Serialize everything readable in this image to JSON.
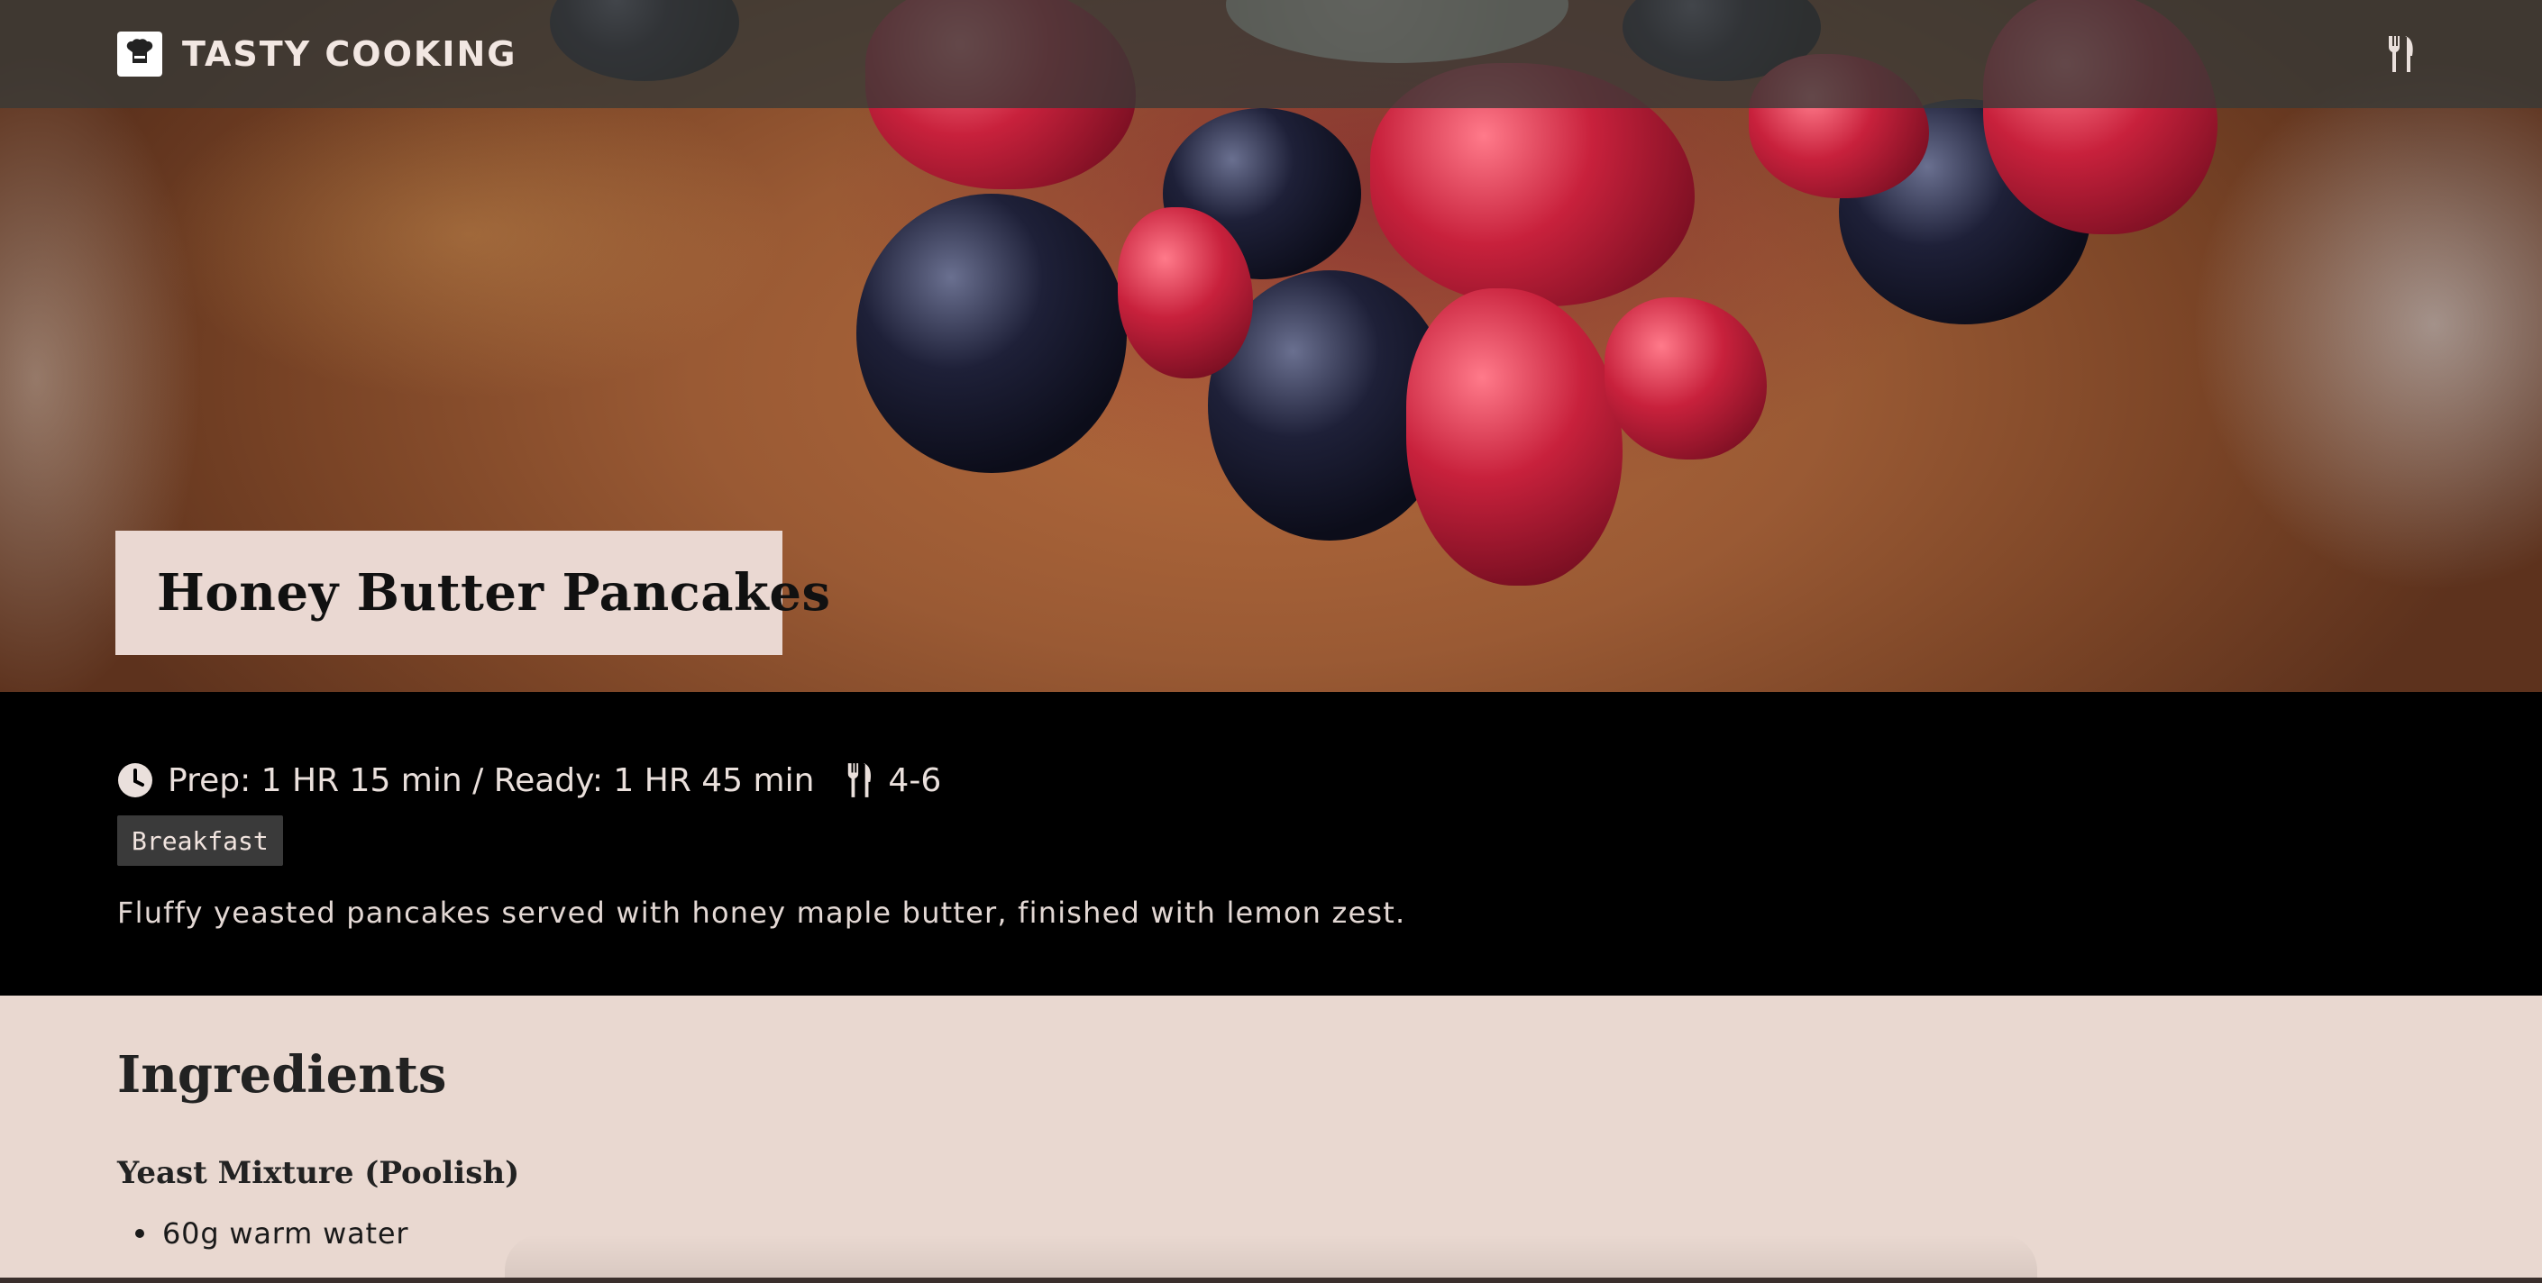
{
  "header": {
    "brand_name": "TASTY COOKING",
    "logo_icon": "chef-hat-icon",
    "menu_icon": "fork-knife-icon"
  },
  "hero": {
    "title": "Honey Butter Pancakes"
  },
  "info": {
    "time_icon": "clock-icon",
    "time_text": "Prep: 1 HR 15 min / Ready: 1 HR 45 min",
    "servings_icon": "fork-knife-icon",
    "servings": "4-6",
    "tag": "Breakfast",
    "description": "Fluffy yeasted pancakes served with honey maple butter, finished with lemon zest."
  },
  "ingredients": {
    "heading": "Ingredients",
    "groups": [
      {
        "title": "Yeast Mixture (Poolish)",
        "items": [
          "60g warm water"
        ]
      }
    ]
  },
  "colors": {
    "header_bg": "#373a37",
    "info_bg": "#000000",
    "page_bg": "#e9d8d0",
    "tag_bg": "#3a3a3a"
  }
}
